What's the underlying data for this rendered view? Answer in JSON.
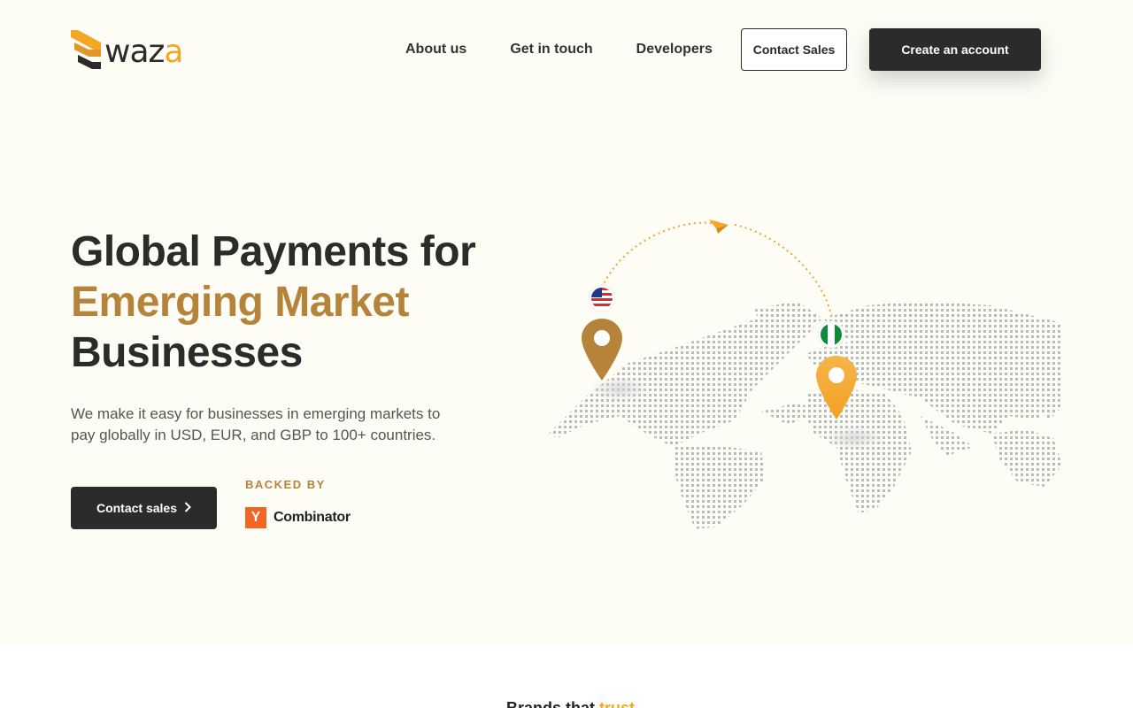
{
  "header": {
    "logo": {
      "text_main": "waz",
      "text_accent": "a"
    },
    "nav": [
      {
        "label": "About us"
      },
      {
        "label": "Get in touch"
      },
      {
        "label": "Developers"
      }
    ],
    "contact_sales_label": "Contact Sales",
    "create_account_label": "Create an account"
  },
  "hero": {
    "headline_line1": "Global Payments for",
    "headline_line2": "Emerging Market",
    "headline_line3": "Businesses",
    "subtext": "We make it easy for businesses in emerging markets to pay globally in USD, EUR, and GBP to 100+ countries.",
    "cta_label": "Contact sales",
    "backed_by_label": "BACKED BY",
    "backer": {
      "mark": "Y",
      "name": "Combinator"
    },
    "map": {
      "origin_flag": "us-flag-icon",
      "destination_flag": "nigeria-flag-icon",
      "route_icon": "paper-plane-icon"
    }
  },
  "bottom": {
    "partial_heading": "Brands that ",
    "partial_heading_accent": "trust"
  },
  "colors": {
    "accent_gold": "#b5843a",
    "accent_orange": "#f5a623",
    "dark": "#2b2b2b",
    "hero_bg": "#fdfdf6",
    "yc_orange": "#f26522"
  }
}
